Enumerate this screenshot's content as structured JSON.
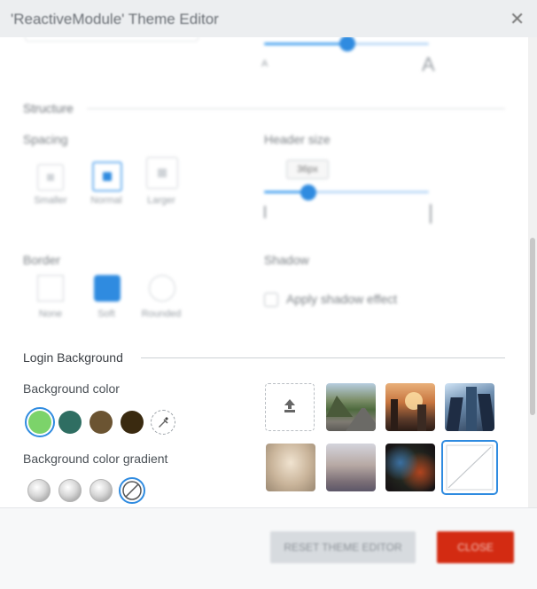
{
  "window": {
    "title": "'ReactiveModule' Theme Editor",
    "close_glyph": "✕"
  },
  "font_slider": {
    "min_label": "A",
    "max_label": "A",
    "value_fraction": 0.5
  },
  "structure": {
    "heading": "Structure",
    "spacing": {
      "label": "Spacing",
      "options": [
        {
          "label": "Smaller",
          "selected": false
        },
        {
          "label": "Normal",
          "selected": true
        },
        {
          "label": "Larger",
          "selected": false
        }
      ]
    },
    "header_size": {
      "label": "Header size",
      "value": "36px",
      "value_fraction": 0.27
    },
    "border": {
      "label": "Border",
      "options": [
        {
          "label": "None",
          "selected": false
        },
        {
          "label": "Soft",
          "selected": true
        },
        {
          "label": "Rounded",
          "selected": false
        }
      ]
    },
    "shadow": {
      "label": "Shadow",
      "checkbox_label": "Apply shadow effect",
      "checked": false
    }
  },
  "login_background": {
    "heading": "Login Background",
    "background_color": {
      "label": "Background color",
      "swatches": [
        "#7cd36a",
        "#2f6e62",
        "#6b5432",
        "#3a2a10"
      ],
      "selected_index": 0
    },
    "gradient": {
      "label": "Background color gradient",
      "options": 4,
      "selected_index": 3
    },
    "images": [
      "upload",
      "mountain-road",
      "industrial-sunset",
      "skyscrapers",
      "blurred-beige",
      "blurred-city",
      "blurred-bokeh",
      "none"
    ],
    "selected_image_index": 7
  },
  "footer": {
    "reset_label": "RESET THEME EDITOR",
    "close_label": "CLOSE"
  },
  "colors": {
    "accent": "#2f8be0",
    "close_button": "#d32b12",
    "reset_button": "#d7dbdf"
  }
}
